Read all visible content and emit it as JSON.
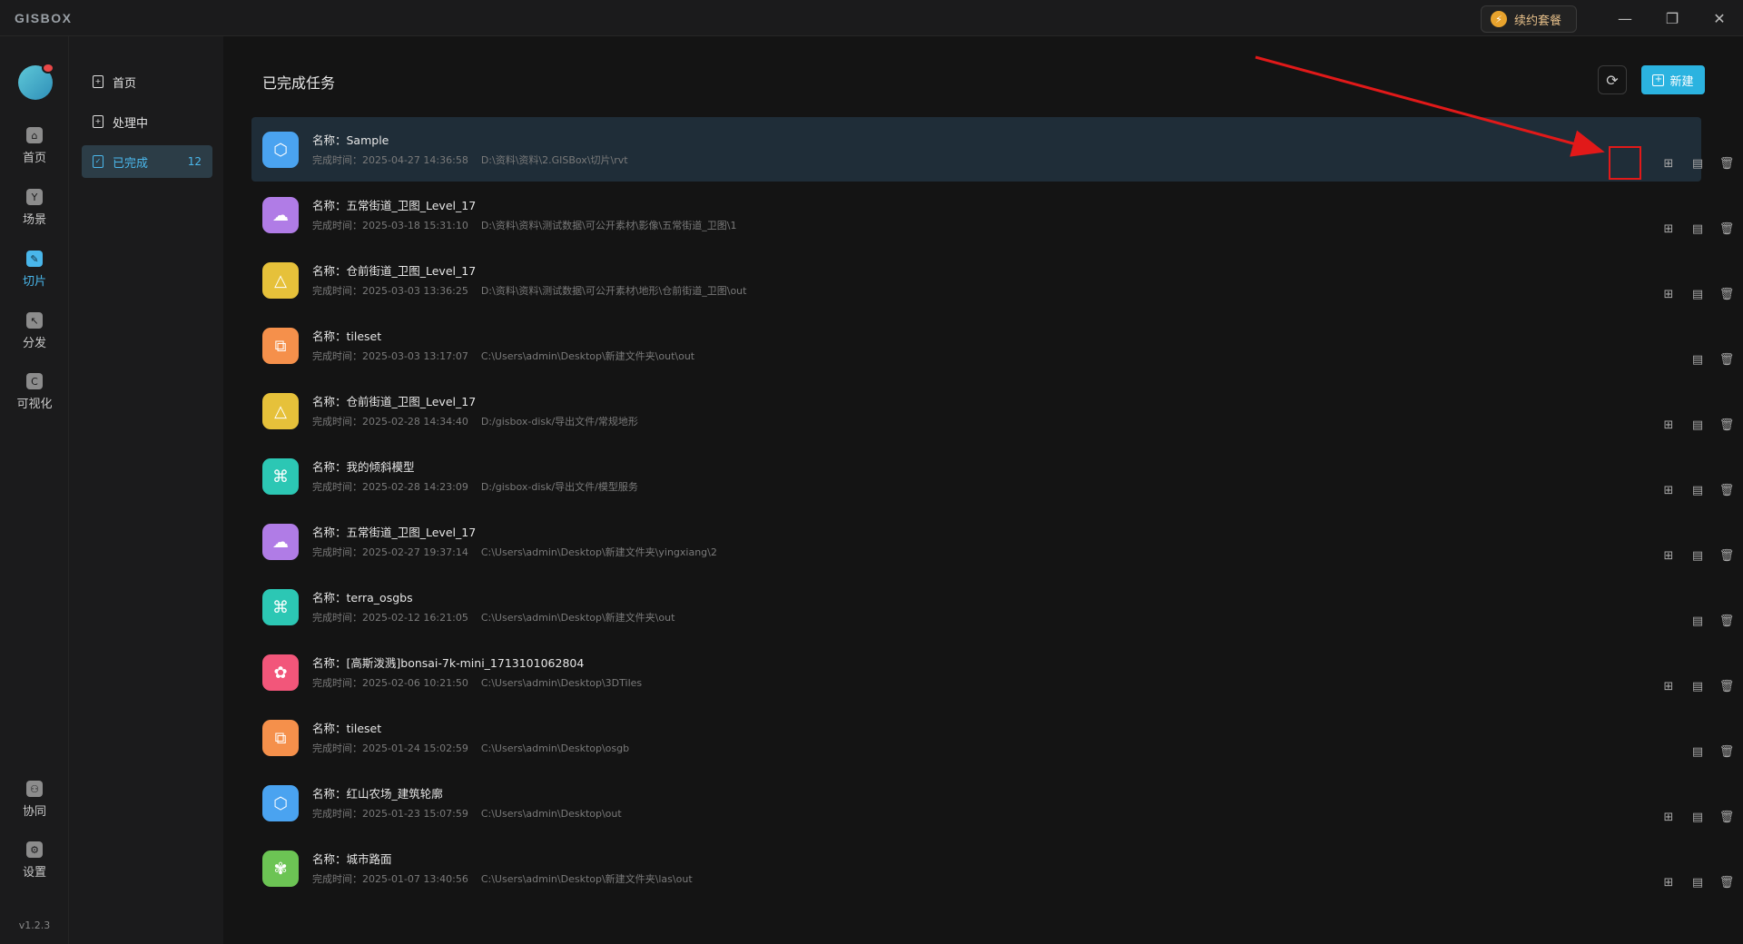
{
  "app": {
    "logo": "GISBOX",
    "renew_label": "续约套餐",
    "min": "—",
    "max": "❐",
    "close": "✕"
  },
  "rail": {
    "items": [
      {
        "label": "首页",
        "icon": "⌂"
      },
      {
        "label": "场景",
        "icon": "Y"
      },
      {
        "label": "切片",
        "icon": "✎"
      },
      {
        "label": "分发",
        "icon": "↖"
      },
      {
        "label": "可视化",
        "icon": "C"
      },
      {
        "label": "协同",
        "icon": "⚇"
      },
      {
        "label": "设置",
        "icon": "⚙"
      }
    ],
    "version": "v1.2.3"
  },
  "subnav": {
    "items": [
      {
        "label": "首页",
        "icon": "+"
      },
      {
        "label": "处理中",
        "icon": "+"
      },
      {
        "label": "已完成",
        "icon": "✓",
        "count": "12"
      }
    ]
  },
  "main": {
    "title": "已完成任务",
    "refresh_icon": "⟳",
    "new_label": "新建",
    "new_icon": "+"
  },
  "tasks": [
    {
      "name": "名称：Sample",
      "time": "完成时间：2025-04-27 14:36:58",
      "path": "D:\\资料\\资料\\2.GISBox\\切片\\rvt",
      "icon": "⬡",
      "color": "#4aa3f0"
    },
    {
      "name": "名称：五常街道_卫图_Level_17",
      "time": "完成时间：2025-03-18 15:31:10",
      "path": "D:\\资料\\资料\\测试数据\\可公开素材\\影像\\五常街道_卫图\\1",
      "icon": "☁",
      "color": "#b07ce6"
    },
    {
      "name": "名称：仓前街道_卫图_Level_17",
      "time": "完成时间：2025-03-03 13:36:25",
      "path": "D:\\资料\\资料\\测试数据\\可公开素材\\地形\\仓前街道_卫图\\out",
      "icon": "△",
      "color": "#e6c13a"
    },
    {
      "name": "名称：tileset",
      "time": "完成时间：2025-03-03 13:17:07",
      "path": "C:\\Users\\admin\\Desktop\\新建文件夹\\out\\out",
      "icon": "⧉",
      "color": "#f5904b"
    },
    {
      "name": "名称：仓前街道_卫图_Level_17",
      "time": "完成时间：2025-02-28 14:34:40",
      "path": "D:/gisbox-disk/导出文件/常规地形",
      "icon": "△",
      "color": "#e6c13a"
    },
    {
      "name": "名称：我的倾斜模型",
      "time": "完成时间：2025-02-28 14:23:09",
      "path": "D:/gisbox-disk/导出文件/模型服务",
      "icon": "⌘",
      "color": "#2cc7b4"
    },
    {
      "name": "名称：五常街道_卫图_Level_17",
      "time": "完成时间：2025-02-27 19:37:14",
      "path": "C:\\Users\\admin\\Desktop\\新建文件夹\\yingxiang\\2",
      "icon": "☁",
      "color": "#b07ce6"
    },
    {
      "name": "名称：terra_osgbs",
      "time": "完成时间：2025-02-12 16:21:05",
      "path": "C:\\Users\\admin\\Desktop\\新建文件夹\\out",
      "icon": "⌘",
      "color": "#2cc7b4"
    },
    {
      "name": "名称：[高斯泼溅]bonsai-7k-mini_1713101062804",
      "time": "完成时间：2025-02-06 10:21:50",
      "path": "C:\\Users\\admin\\Desktop\\3DTiles",
      "icon": "✿",
      "color": "#f2567a"
    },
    {
      "name": "名称：tileset",
      "time": "完成时间：2025-01-24 15:02:59",
      "path": "C:\\Users\\admin\\Desktop\\osgb",
      "icon": "⧉",
      "color": "#f5904b"
    },
    {
      "name": "名称：红山农场_建筑轮廓",
      "time": "完成时间：2025-01-23 15:07:59",
      "path": "C:\\Users\\admin\\Desktop\\out",
      "icon": "⬡",
      "color": "#4aa3f0"
    },
    {
      "name": "名称：城市路面",
      "time": "完成时间：2025-01-07 13:40:56",
      "path": "C:\\Users\\admin\\Desktop\\新建文件夹\\las\\out",
      "icon": "✾",
      "color": "#6cc454"
    }
  ],
  "action_icons": {
    "structure": "⊞",
    "doc": "▤",
    "delete": "🗑"
  }
}
